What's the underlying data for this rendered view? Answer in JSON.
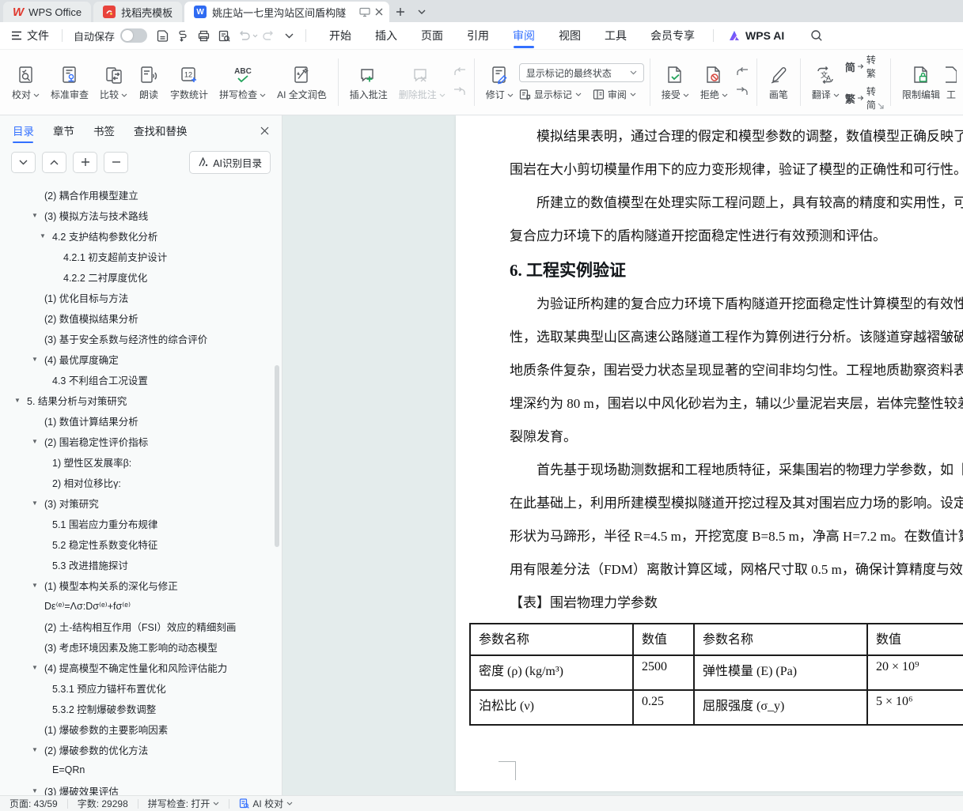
{
  "tabbar": {
    "tabs": [
      {
        "label": "WPS Office"
      },
      {
        "label": "找稻壳模板"
      },
      {
        "label": "姚庄站一七里沟站区间盾构隧"
      }
    ]
  },
  "menubar": {
    "file": "文件",
    "autosave": "自动保存",
    "items": [
      "开始",
      "插入",
      "页面",
      "引用",
      "审阅",
      "视图",
      "工具",
      "会员专享"
    ],
    "active": "审阅",
    "wps_ai": "WPS AI"
  },
  "ribbon": {
    "proofread": "校对",
    "standard_review": "标准审查",
    "compare": "比较",
    "read_aloud": "朗读",
    "word_count": "字数统计",
    "word_count_glyph": "12",
    "spell_check": "拼写检查",
    "spell_glyph": "ABC",
    "ai_polish": "AI 全文润色",
    "insert_comment": "插入批注",
    "delete_comment": "删除批注",
    "track_changes": "修订",
    "markup_state": "显示标记的最终状态",
    "show_markup": "显示标记",
    "review_pane": "审阅",
    "accept": "接受",
    "reject": "拒绝",
    "pen": "画笔",
    "translate": "翻译",
    "s2t_glyph": "简",
    "s2t": "转繁",
    "t2s_glyph": "繁",
    "t2s": "转简",
    "restrict_edit": "限制编辑",
    "clipped_label": "工"
  },
  "sidebar": {
    "tabs": [
      "目录",
      "章节",
      "书签",
      "查找和替换"
    ],
    "active_tab": "目录",
    "ai_toc_button": "AI识别目录",
    "toc": [
      {
        "text": "(2) 耦合作用模型建立",
        "indent": 2,
        "tri": false
      },
      {
        "text": "(3) 模拟方法与技术路线",
        "indent": 2,
        "tri": true
      },
      {
        "text": "4.2 支护结构参数化分析",
        "indent": 3,
        "tri": true
      },
      {
        "text": "4.2.1 初支超前支护设计",
        "indent": 4,
        "tri": false
      },
      {
        "text": "4.2.2 二衬厚度优化",
        "indent": 4,
        "tri": false
      },
      {
        "text": "(1) 优化目标与方法",
        "indent": 2,
        "tri": false
      },
      {
        "text": "(2) 数值模拟结果分析",
        "indent": 2,
        "tri": false
      },
      {
        "text": "(3) 基于安全系数与经济性的综合评价",
        "indent": 2,
        "tri": false
      },
      {
        "text": "(4) 最优厚度确定",
        "indent": 2,
        "tri": true
      },
      {
        "text": "4.3 不利组合工况设置",
        "indent": 3,
        "tri": false
      },
      {
        "text": "5. 结果分析与对策研究",
        "indent": 1,
        "tri": true
      },
      {
        "text": "(1) 数值计算结果分析",
        "indent": 2,
        "tri": false
      },
      {
        "text": "(2) 围岩稳定性评价指标",
        "indent": 2,
        "tri": true
      },
      {
        "text": "1) 塑性区发展率β:",
        "indent": 3,
        "tri": false
      },
      {
        "text": "2) 相对位移比γ:",
        "indent": 3,
        "tri": false
      },
      {
        "text": "(3) 对策研究",
        "indent": 2,
        "tri": true
      },
      {
        "text": "5.1 围岩应力重分布规律",
        "indent": 3,
        "tri": false
      },
      {
        "text": "5.2 稳定性系数变化特征",
        "indent": 3,
        "tri": false
      },
      {
        "text": "5.3 改进措施探讨",
        "indent": 3,
        "tri": false
      },
      {
        "text": "(1) 模型本构关系的深化与修正",
        "indent": 2,
        "tri": true
      },
      {
        "text": "Dε⁽ᵉ⁾=Λσ:Dσ⁽ᵉ⁾+fσ⁽ᵉ⁾",
        "indent": 2,
        "tri": false
      },
      {
        "text": "(2) 土-结构相互作用（FSI）效应的精细刻画",
        "indent": 2,
        "tri": false
      },
      {
        "text": "(3) 考虑环境因素及施工影响的动态模型",
        "indent": 2,
        "tri": false
      },
      {
        "text": "(4) 提高模型不确定性量化和风险评估能力",
        "indent": 2,
        "tri": true
      },
      {
        "text": "5.3.1 预应力锚杆布置优化",
        "indent": 3,
        "tri": false
      },
      {
        "text": "5.3.2 控制爆破参数调整",
        "indent": 3,
        "tri": false
      },
      {
        "text": "(1) 爆破参数的主要影响因素",
        "indent": 2,
        "tri": false
      },
      {
        "text": "(2) 爆破参数的优化方法",
        "indent": 2,
        "tri": true
      },
      {
        "text": "E=QRn",
        "indent": 3,
        "tri": false
      },
      {
        "text": "(3) 爆破效果评估",
        "indent": 2,
        "tri": true
      }
    ]
  },
  "document": {
    "blocks": [
      {
        "type": "line",
        "indent": true,
        "text": "模拟结果表明，通过合理的假定和模型参数的调整，数值模型正确反映了隧"
      },
      {
        "type": "line",
        "indent": false,
        "text": "围岩在大小剪切模量作用下的应力变形规律，验证了模型的正确性和可行性。"
      },
      {
        "type": "line",
        "indent": true,
        "text": "所建立的数值模型在处理实际工程问题上，具有较高的精度和实用性，可以"
      },
      {
        "type": "line",
        "indent": false,
        "text": "复合应力环境下的盾构隧道开挖面稳定性进行有效预测和评估。"
      },
      {
        "type": "heading",
        "text": "6. 工程实例验证"
      },
      {
        "type": "line",
        "indent": true,
        "text": "为验证所构建的复合应力环境下盾构隧道开挖面稳定性计算模型的有效性和"
      },
      {
        "type": "line",
        "indent": false,
        "text": "性，选取某典型山区高速公路隧道工程作为算例进行分析。该隧道穿越褶皱破碎"
      },
      {
        "type": "line",
        "indent": false,
        "text": "地质条件复杂，围岩受力状态呈现显著的空间非均匀性。工程地质勘察资料表明"
      },
      {
        "type": "line",
        "indent": false,
        "text": "埋深约为 80 m，围岩以中风化砂岩为主，辅以少量泥岩夹层，岩体完整性较差"
      },
      {
        "type": "line",
        "indent": false,
        "text": "裂隙发育。"
      },
      {
        "type": "line",
        "indent": true,
        "text": "首先基于现场勘测数据和工程地质特征，采集围岩的物理力学参数，如【表"
      },
      {
        "type": "line",
        "indent": false,
        "text": "在此基础上，利用所建模型模拟隧道开挖过程及其对围岩应力场的影响。设定隧"
      },
      {
        "type": "line",
        "indent": false,
        "text": "形状为马蹄形，半径 R=4.5 m，开挖宽度 B=8.5 m，净高 H=7.2 m。在数值计算"
      },
      {
        "type": "line",
        "indent": false,
        "text": "用有限差分法（FDM）离散计算区域，网格尺寸取 0.5 m，确保计算精度与效率的"
      },
      {
        "type": "line",
        "indent": false,
        "text": "【表】围岩物理力学参数"
      }
    ],
    "table": {
      "headers": [
        "参数名称",
        "数值",
        "参数名称",
        "数值"
      ],
      "rows": [
        [
          "密度 (ρ) (kg/m³)",
          "2500",
          "弹性模量 (E) (Pa)",
          "20 × 10⁹"
        ],
        [
          "泊松比 (ν)",
          "0.25",
          "屈服强度 (σ_y)",
          "5 × 10⁶"
        ]
      ]
    }
  },
  "statusbar": {
    "page": "页面: 43/59",
    "words": "字数: 29298",
    "spell": "拼写检查: 打开",
    "ai_proof": "AI 校对"
  },
  "colors": {
    "accent_blue": "#3370ff",
    "wps_red": "#e0392e",
    "docer_red": "#e8433c",
    "word_doc_blue": "#2f6bf2",
    "green": "#21a35a",
    "reject_red": "#d54941",
    "doc_background": "#e4ecec"
  }
}
